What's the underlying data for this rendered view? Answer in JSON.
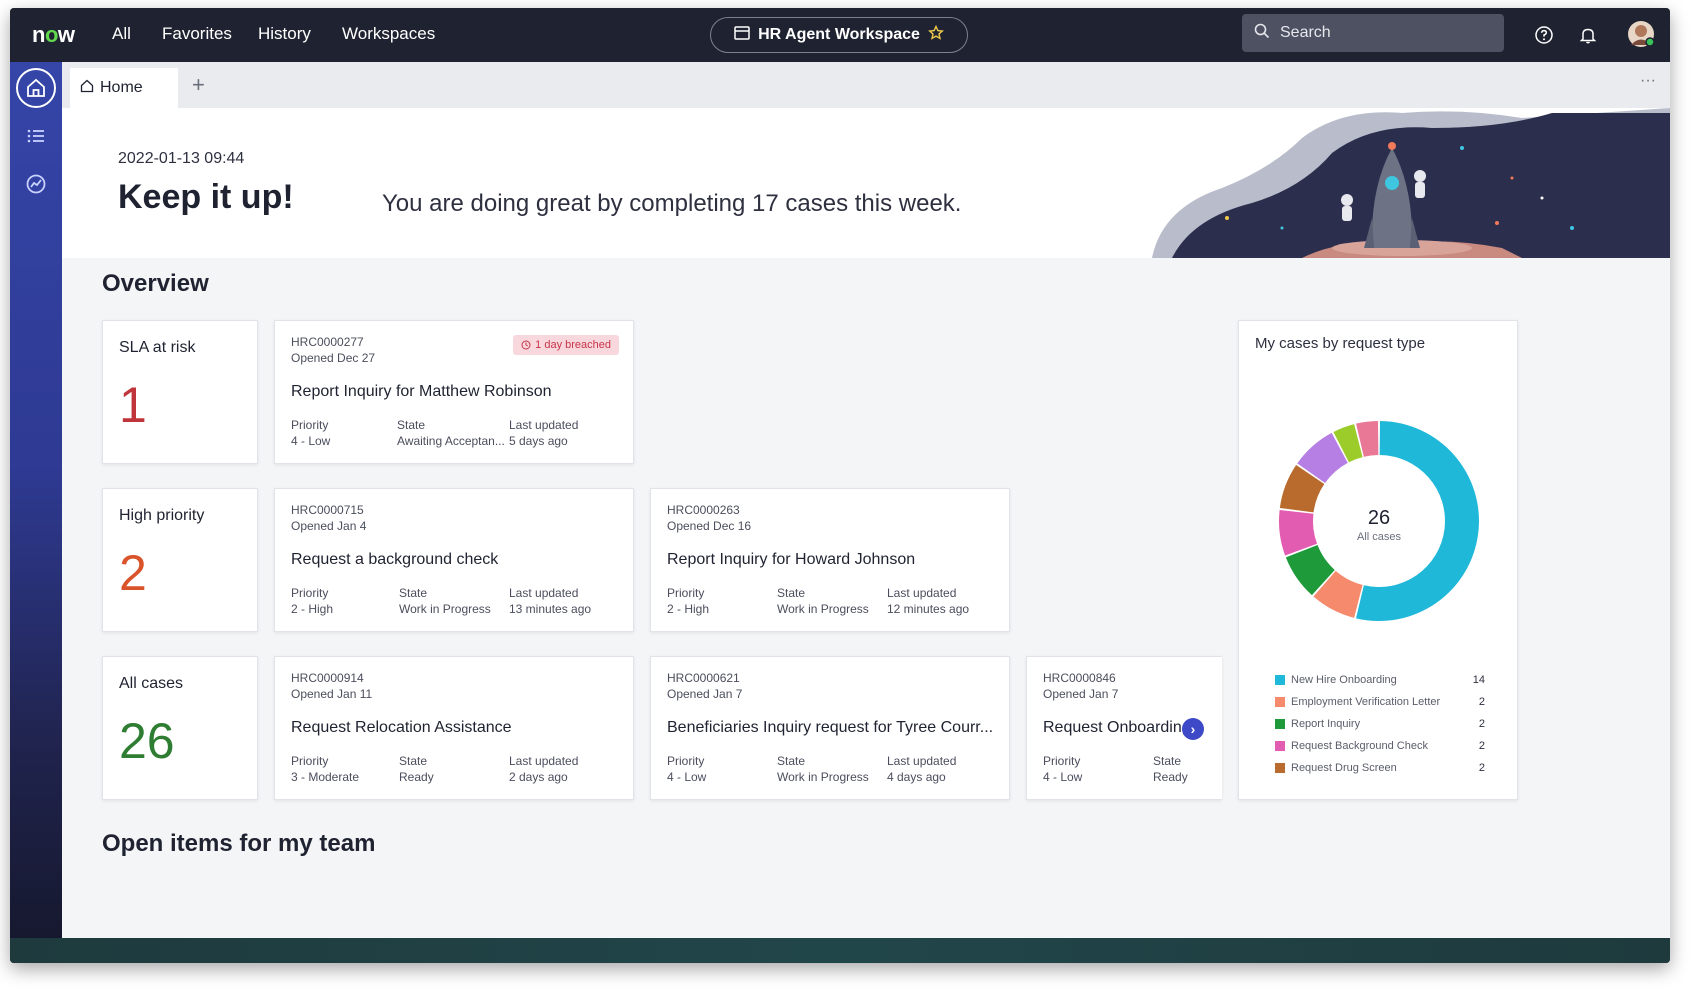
{
  "topbar": {
    "logo": {
      "n": "n",
      "o": "o",
      "w": "w"
    },
    "nav": [
      "All",
      "Favorites",
      "History",
      "Workspaces"
    ],
    "workspace": "HR Agent Workspace",
    "search_placeholder": "Search"
  },
  "tabs": {
    "home": "Home",
    "add": "+",
    "more": "···"
  },
  "banner": {
    "timestamp": "2022-01-13 09:44",
    "cheer": "Keep it up!",
    "message": "You are doing great by completing 17 cases this week."
  },
  "overview": {
    "title": "Overview",
    "stats": [
      {
        "label": "SLA at risk",
        "value": "1",
        "color": "#c0343b"
      },
      {
        "label": "High priority",
        "value": "2",
        "color": "#d9542a"
      },
      {
        "label": "All cases",
        "value": "26",
        "color": "#2e7d32"
      }
    ],
    "field_labels": {
      "priority": "Priority",
      "state": "State",
      "updated": "Last updated"
    },
    "cases": [
      {
        "number": "HRC0000277",
        "opened": "Opened Dec 27",
        "title": "Report Inquiry for Matthew Robinson",
        "priority": "4 - Low",
        "state": "Awaiting Acceptan...",
        "updated": "5 days ago",
        "badge": "1 day breached"
      },
      {
        "number": "HRC0000715",
        "opened": "Opened Jan 4",
        "title": "Request a background check",
        "priority": "2 - High",
        "state": "Work in Progress",
        "updated": "13 minutes ago"
      },
      {
        "number": "HRC0000263",
        "opened": "Opened Dec 16",
        "title": "Report Inquiry for Howard Johnson",
        "priority": "2 - High",
        "state": "Work in Progress",
        "updated": "12 minutes ago"
      },
      {
        "number": "HRC0000914",
        "opened": "Opened Jan 11",
        "title": "Request Relocation Assistance",
        "priority": "3 - Moderate",
        "state": "Ready",
        "updated": "2 days ago"
      },
      {
        "number": "HRC0000621",
        "opened": "Opened Jan 7",
        "title": "Beneficiaries Inquiry request for Tyree Courr...",
        "priority": "4 - Low",
        "state": "Work in Progress",
        "updated": "4 days ago"
      },
      {
        "number": "HRC0000846",
        "opened": "Opened Jan 7",
        "title": "Request Onboarding",
        "priority": "4 - Low",
        "state": "Ready"
      }
    ]
  },
  "donut": {
    "title": "My cases by request type",
    "total": "26",
    "total_label": "All cases"
  },
  "chart_data": {
    "type": "pie",
    "title": "My cases by request type",
    "total": 26,
    "categories": [
      "New Hire Onboarding",
      "Employment Verification Letter",
      "Report Inquiry",
      "Request Background Check",
      "Request Drug Screen"
    ],
    "values": [
      14,
      2,
      2,
      2,
      2
    ],
    "colors": [
      "#1fb8d9",
      "#f58b6c",
      "#1f9a3a",
      "#e25db1",
      "#b86b2c"
    ],
    "extra_segment_colors": [
      "#b67fe3",
      "#9ccc2a",
      "#e97896"
    ],
    "legend_position": "bottom"
  },
  "team": {
    "title": "Open items for my team"
  }
}
